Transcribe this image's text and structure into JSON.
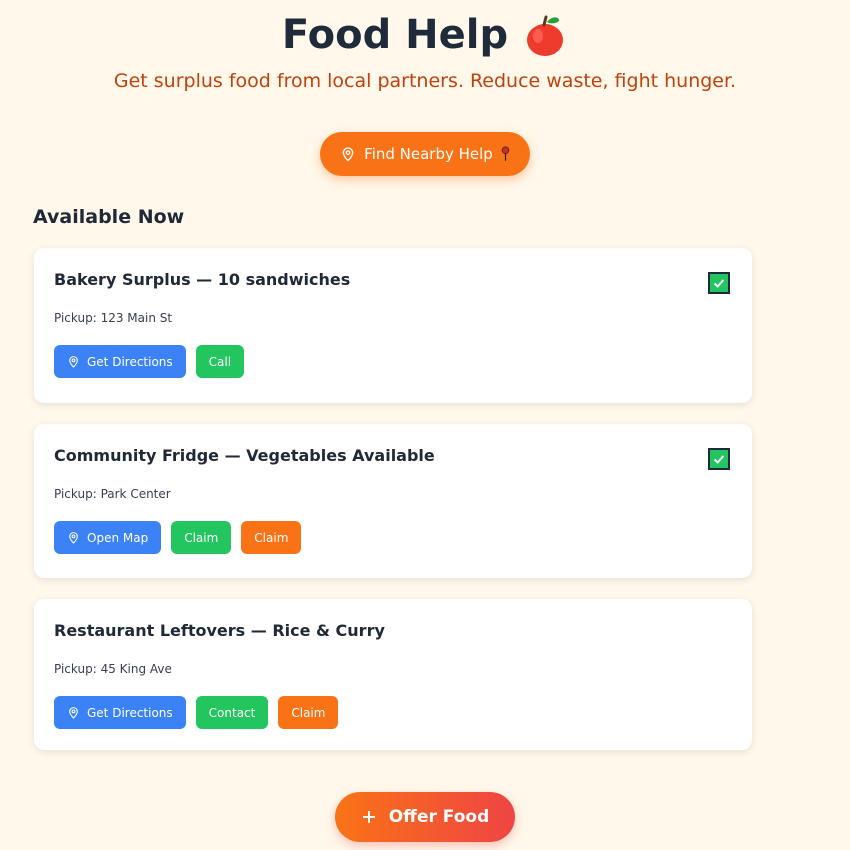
{
  "header": {
    "title": "Food Help",
    "title_icon": "apple-icon",
    "subtitle": "Get surplus food from local partners. Reduce waste, fight hunger."
  },
  "find_button": {
    "label": "Find Nearby Help",
    "icon": "map-pin-icon",
    "trailing_icon": "pushpin-icon"
  },
  "section_title": "Available Now",
  "cards": [
    {
      "title": "Bakery Surplus — 10 sandwiches",
      "pickup": "Pickup: 123 Main St",
      "checked": true,
      "actions": [
        {
          "label": "Get Directions",
          "icon": "map-pin-icon",
          "color": "#3b82f6"
        },
        {
          "label": "Call",
          "color": "#22c55e"
        }
      ]
    },
    {
      "title": "Community Fridge — Vegetables Available",
      "pickup": "Pickup: Park Center",
      "checked": true,
      "actions": [
        {
          "label": "Open Map",
          "icon": "map-pin-icon",
          "color": "#3b82f6"
        },
        {
          "label": "Claim",
          "color": "#22c55e"
        },
        {
          "label": "Claim",
          "color": "#f97316"
        }
      ]
    },
    {
      "title": "Restaurant Leftovers — Rice & Curry",
      "pickup": "Pickup: 45 King Ave",
      "checked": false,
      "actions": [
        {
          "label": "Get Directions",
          "icon": "map-pin-icon",
          "color": "#3b82f6"
        },
        {
          "label": "Contact",
          "color": "#22c55e"
        },
        {
          "label": "Claim",
          "color": "#f97316"
        }
      ]
    }
  ],
  "offer_button": {
    "label": "Offer Food",
    "icon": "plus-icon"
  },
  "colors": {
    "background": "#fff8eb",
    "accent_orange": "#f97316",
    "subtitle": "#c2410c",
    "blue": "#3b82f6",
    "green": "#22c55e"
  }
}
